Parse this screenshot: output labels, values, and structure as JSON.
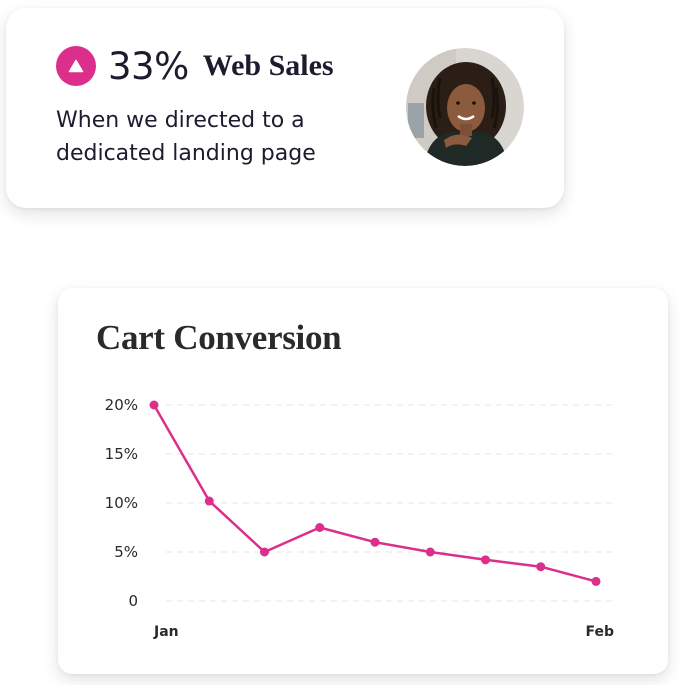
{
  "stat_card": {
    "direction_icon": "triangle-up-icon",
    "value": "33%",
    "label": "Web Sales",
    "description": "When we directed to a dedicated landing page",
    "avatar_icon": "person-avatar-icon"
  },
  "colors": {
    "accent": "#db2f8b",
    "text_dark": "#1f1b2e",
    "grid": "#e4e4e4"
  },
  "chart_data": {
    "type": "line",
    "title": "Cart Conversion",
    "xlabel": "",
    "ylabel": "",
    "x_tick_labels": [
      "Jan",
      "Feb"
    ],
    "y_tick_labels": [
      "0",
      "5%",
      "10%",
      "15%",
      "20%"
    ],
    "ylim": [
      0,
      20
    ],
    "grid": true,
    "series": [
      {
        "values": [
          20,
          10.2,
          5,
          7.5,
          6,
          5,
          4.2,
          3.5,
          2
        ]
      }
    ]
  }
}
